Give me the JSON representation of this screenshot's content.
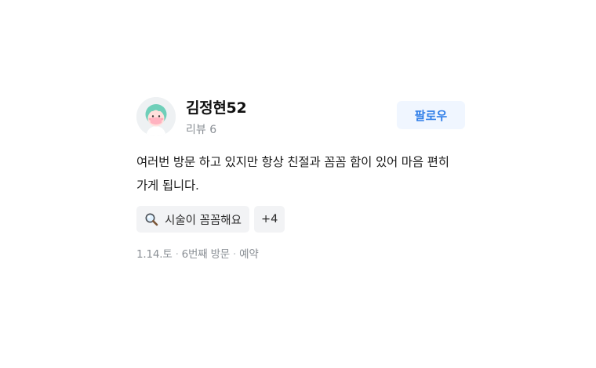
{
  "reviewer": {
    "name": "김정현52",
    "review_count": "리뷰 6",
    "avatar_icon": "cartoon-face-avatar"
  },
  "follow_button": {
    "label": "팔로우"
  },
  "review": {
    "text": "여러번 방문 하고 있지만 항상 친절과 꼼꼼 함이 있어 마음 편히 가게 됩니다."
  },
  "tags": {
    "items": [
      {
        "icon": "magnifier-icon",
        "label": "시술이 꼼꼼해요"
      }
    ],
    "more_label": "+4"
  },
  "meta": {
    "date": "1.14.토",
    "visit": "6번째 방문",
    "method": "예약"
  },
  "colors": {
    "accent": "#2f7ee8",
    "follow_bg": "#f0f6ff",
    "tag_bg": "#f2f3f5",
    "muted_text": "#8a8f95"
  }
}
